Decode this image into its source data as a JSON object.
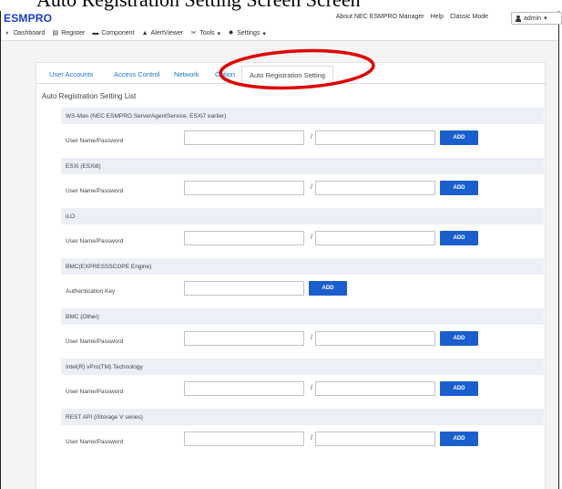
{
  "app": {
    "brand": "ESMPRO",
    "top_links": [
      "About NEC ESMPRO Manager",
      "Help",
      "Classic Mode"
    ],
    "user": "admin"
  },
  "nav": {
    "items": [
      {
        "label": "Dashboard",
        "icon": "dashboard-icon"
      },
      {
        "label": "Register",
        "icon": "register-icon"
      },
      {
        "label": "Component",
        "icon": "component-icon"
      },
      {
        "label": "AlertViewer",
        "icon": "alert-icon"
      },
      {
        "label": "Tools",
        "icon": "tools-icon"
      },
      {
        "label": "Settings",
        "icon": "settings-icon"
      }
    ]
  },
  "tabs": [
    "User Accounts",
    "Access Control",
    "Network",
    "Option",
    "Auto Registration Setting"
  ],
  "active_tab": "Auto Registration Setting",
  "section_title": "Auto Registration Setting List",
  "groups": [
    {
      "header": "WS-Man (NEC ESMPRO ServerAgentService, ESXi7 earlier)",
      "label": "User Name/Password",
      "button": "ADD"
    },
    {
      "header": "ESXi (ESXi8)",
      "label": "User Name/Password",
      "button": "ADD"
    },
    {
      "header": "iLO",
      "label": "User Name/Password",
      "button": "ADD"
    },
    {
      "header": "BMC(EXPRESSSCOPE Engine)",
      "label": "Authentication Key",
      "button": "ADD"
    },
    {
      "header": "BMC (Other)",
      "label": "User Name/Password",
      "button": "ADD"
    },
    {
      "header": "Intel(R) vPro(TM) Technology",
      "label": "User Name/Password",
      "button": "ADD"
    },
    {
      "header": "REST API (iStorage V series)",
      "label": "User Name/Password",
      "button": "ADD"
    }
  ],
  "separator": "/",
  "colors": {
    "brand": "#1a3cc9",
    "tab_link": "#1a73c9",
    "add_button": "#1b5fcf",
    "group_header": "#eceff6",
    "highlight_oval": "#e00000"
  }
}
